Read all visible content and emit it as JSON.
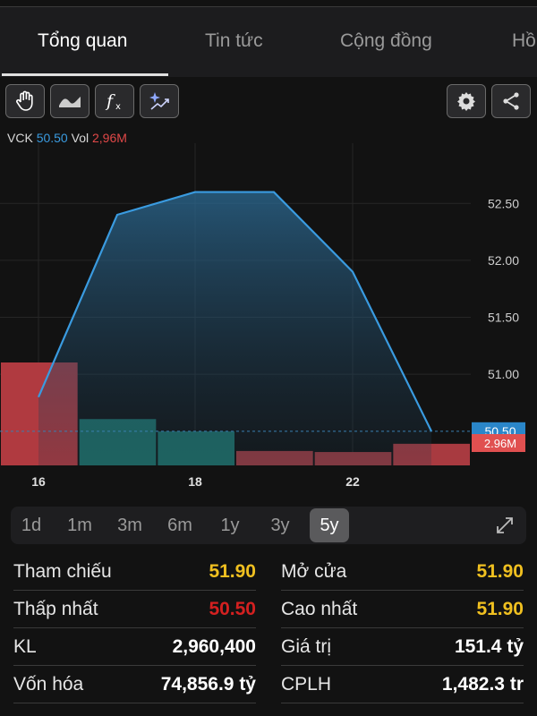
{
  "tabs": [
    {
      "label": "Tổng quan",
      "active": true
    },
    {
      "label": "Tin tức",
      "active": false
    },
    {
      "label": "Cộng đồng",
      "active": false
    },
    {
      "label": "Hồ",
      "active": false
    }
  ],
  "toolbar": {
    "left_icons": [
      "hand-cursor-icon",
      "area-chart-icon",
      "function-fx-icon",
      "ai-sparkle-trend-icon"
    ],
    "right_icons": [
      "gear-icon",
      "share-icon"
    ]
  },
  "legend": {
    "symbol": "VCK",
    "price": "50.50",
    "vol_label": "Vol",
    "volume": "2,96M"
  },
  "chart_data": {
    "type": "line",
    "x_tick_labels": [
      "16",
      "18",
      "22"
    ],
    "y_tick_labels": [
      "52.50",
      "52.00",
      "51.50",
      "51.00"
    ],
    "ylim": [
      50.2,
      52.95
    ],
    "price_series": {
      "name": "VCK",
      "values": [
        50.8,
        52.4,
        52.6,
        52.6,
        51.9,
        50.5
      ]
    },
    "volume_series": {
      "name": "Vol",
      "values": [
        1.0,
        0.45,
        0.33,
        0.14,
        0.13,
        0.21
      ],
      "colors": [
        "#b03a40",
        "#1f6e66",
        "#1f6e66",
        "#9a3a40",
        "#9a3a40",
        "#a83a40"
      ]
    },
    "last_price_label": "50.50",
    "last_volume_label": "2.96M",
    "colors": {
      "price": "#3a9be0",
      "volume_up": "#1f6e66",
      "volume_down": "#b03a40"
    }
  },
  "periods": [
    {
      "label": "1d",
      "active": false
    },
    {
      "label": "1m",
      "active": false
    },
    {
      "label": "3m",
      "active": false
    },
    {
      "label": "6m",
      "active": false
    },
    {
      "label": "1y",
      "active": false
    },
    {
      "label": "3y",
      "active": false
    },
    {
      "label": "5y",
      "active": true
    }
  ],
  "stats": {
    "left": [
      {
        "label": "Tham chiếu",
        "value": "51.90",
        "color": "yellow"
      },
      {
        "label": "Thấp nhất",
        "value": "50.50",
        "color": "red"
      },
      {
        "label": "KL",
        "value": "2,960,400",
        "color": "white"
      },
      {
        "label": "Vốn hóa",
        "value": "74,856.9 tỷ",
        "color": "white"
      }
    ],
    "right": [
      {
        "label": "Mở cửa",
        "value": "51.90",
        "color": "yellow"
      },
      {
        "label": "Cao nhất",
        "value": "51.90",
        "color": "yellow"
      },
      {
        "label": "Giá trị",
        "value": "151.4 tỷ",
        "color": "white"
      },
      {
        "label": "CPLH",
        "value": "1,482.3 tr",
        "color": "white"
      }
    ]
  }
}
